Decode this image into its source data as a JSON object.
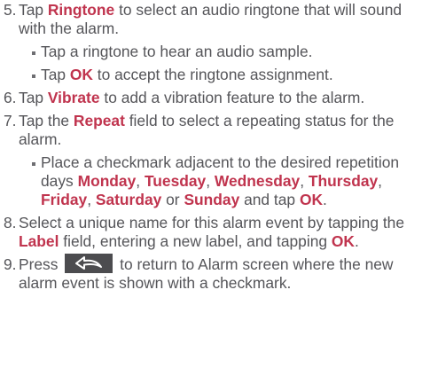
{
  "steps": [
    {
      "num": "5.",
      "t1": "Tap ",
      "b1": "Ringtone",
      "t2": " to select an audio ringtone that will sound with the alarm.",
      "subs": [
        {
          "t1": "Tap a ringtone to hear an audio sample."
        },
        {
          "t1": "Tap ",
          "b1": "OK",
          "t2": " to accept the ringtone assignment."
        }
      ]
    },
    {
      "num": "6.",
      "t1": "Tap ",
      "b1": "Vibrate",
      "t2": " to add a vibration feature to the alarm."
    },
    {
      "num": "7.",
      "t1": "Tap the ",
      "b1": "Repeat",
      "t2": " field to select a repeating status for the alarm.",
      "sub": {
        "t1": "Place a checkmark adjacent to the desired repetition days ",
        "d1": "Monday",
        "s1": ", ",
        "d2": "Tuesday",
        "s2": ", ",
        "d3": "Wednesday",
        "s3": ", ",
        "d4": "Thursday",
        "s4": ", ",
        "d5": "Friday",
        "s5": ", ",
        "d6": "Saturday",
        "s6": " or ",
        "d7": "Sunday",
        "s7": " and tap ",
        "d8": "OK",
        "s8": "."
      }
    },
    {
      "num": "8.",
      "t1": "Select a unique name for this alarm event by tapping the ",
      "b1": "Label",
      "t2": " field, entering a new label, and tapping ",
      "b2": "OK",
      "t3": "."
    },
    {
      "num": "9.",
      "t1": "Press ",
      "icon": "back-icon",
      "t2": " to return to Alarm screen where the new alarm event is shown with a checkmark."
    }
  ],
  "colors": {
    "text": "#555559",
    "keyword": "#c0344e",
    "back_button": "#4c4c4f"
  }
}
